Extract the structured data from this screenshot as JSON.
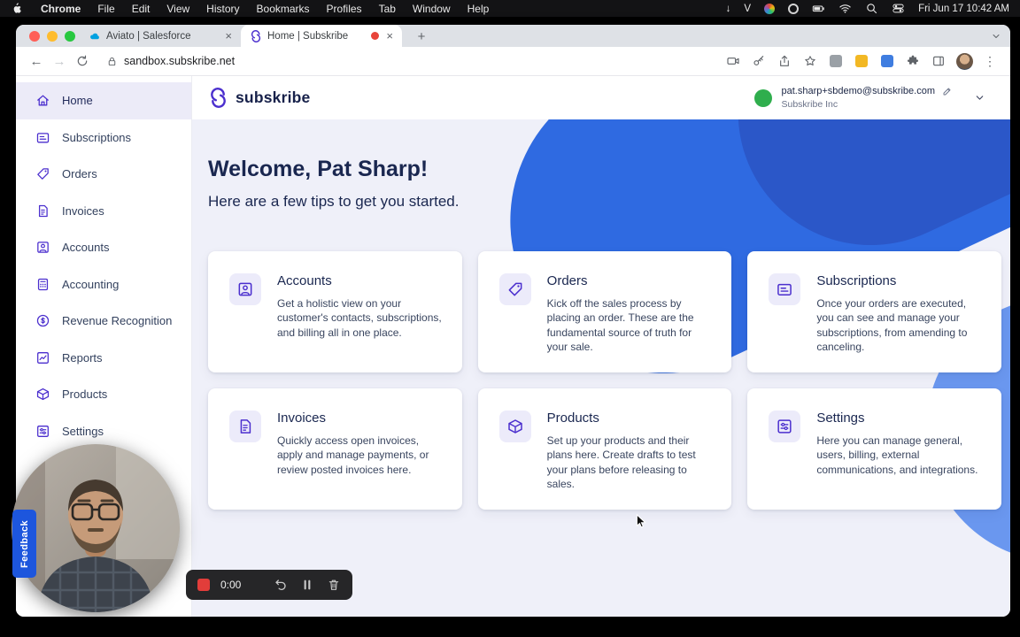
{
  "menubar": {
    "app_name": "Chrome",
    "items": [
      "File",
      "Edit",
      "View",
      "History",
      "Bookmarks",
      "Profiles",
      "Tab",
      "Window",
      "Help"
    ],
    "extra_item": "V",
    "clock": "Fri Jun 17 10:42 AM"
  },
  "browser": {
    "tabs": [
      {
        "title": "Aviato | Salesforce"
      },
      {
        "title": "Home | Subskribe"
      }
    ],
    "url": "sandbox.subskribe.net"
  },
  "icons": {
    "close": "×",
    "new_tab": "+",
    "menu_dots": "⋮",
    "back": "←",
    "forward": "→",
    "download": "↓"
  },
  "app": {
    "brand": "subskribe",
    "account": {
      "email": "pat.sharp+sbdemo@subskribe.com",
      "org": "Subskribe Inc"
    },
    "sidebar": [
      {
        "label": "Home",
        "active": true
      },
      {
        "label": "Subscriptions"
      },
      {
        "label": "Orders"
      },
      {
        "label": "Invoices"
      },
      {
        "label": "Accounts"
      },
      {
        "label": "Accounting"
      },
      {
        "label": "Revenue Recognition"
      },
      {
        "label": "Reports"
      },
      {
        "label": "Products"
      },
      {
        "label": "Settings"
      }
    ],
    "welcome_title": "Welcome, Pat Sharp!",
    "welcome_subtitle": "Here are a few tips to get you started.",
    "cards": [
      {
        "title": "Accounts",
        "description": "Get a holistic view on your customer's contacts, subscriptions, and billing all in one place."
      },
      {
        "title": "Orders",
        "description": "Kick off the sales process by placing an order. These are the fundamental source of truth for your sale."
      },
      {
        "title": "Subscriptions",
        "description": "Once your orders are executed, you can see and manage your subscriptions, from amending to canceling."
      },
      {
        "title": "Invoices",
        "description": "Quickly access open invoices, apply and manage payments, or review posted invoices here."
      },
      {
        "title": "Products",
        "description": "Set up your products and their plans here. Create drafts to test your plans before releasing to sales."
      },
      {
        "title": "Settings",
        "description": "Here you can manage general, users, billing, external communications, and integrations."
      }
    ],
    "colors": {
      "brand_purple": "#4b2fce",
      "bg_lavender": "#eff0f9",
      "blue_shape": "#2f6ae1",
      "blue_dark": "#2b57c8"
    }
  },
  "recorder": {
    "time": "0:00"
  },
  "feedback": {
    "label": "Feedback"
  }
}
